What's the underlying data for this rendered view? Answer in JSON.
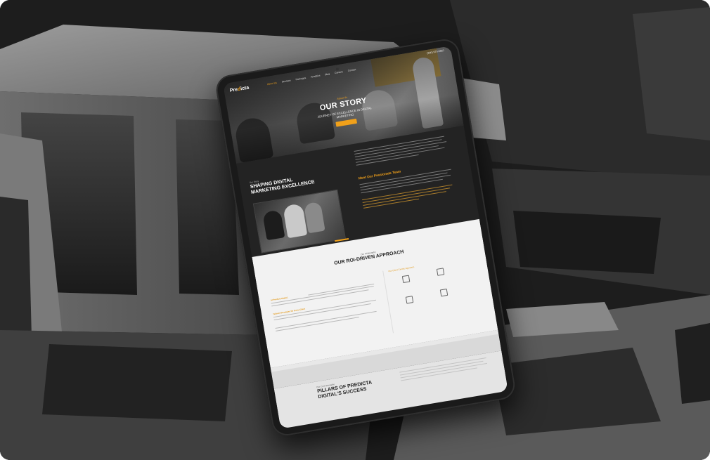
{
  "site": {
    "logo_prefix": "Pre",
    "logo_accent": "d",
    "logo_suffix": "icta",
    "phone": "(800) 970-6810",
    "nav": [
      "About Us",
      "Services",
      "Packages",
      "Analytics",
      "Blog",
      "Careers",
      "Contact"
    ]
  },
  "hero": {
    "eyebrow": "About Us",
    "title": "OUR STORY",
    "subtitle_line1": "JOURNEY OF EXCELLENCE IN DIGITAL",
    "subtitle_line2": "MARKETING"
  },
  "intro": {
    "eyebrow": "Our Story",
    "title_line1": "SHAPING DIGITAL",
    "title_line2": "MARKETING EXCELLENCE",
    "team_title": "Meet Our Passionate Team"
  },
  "approach": {
    "eyebrow": "Our Philosophy",
    "title": "OUR ROI-DRIVEN APPROACH",
    "p1_highlight": "At Predicta Digital,",
    "p2_highlight": "Tailored Strategies for Every Client",
    "features_title": "Our Client Centric Approach"
  },
  "pillars": {
    "eyebrow": "Our Core Strengths",
    "title_line1": "PILLARS OF PREDICTA",
    "title_line2": "DIGITAL'S SUCCESS"
  },
  "colors": {
    "accent": "#f0a01a",
    "dark": "#232323",
    "light": "#f2f2f2"
  }
}
